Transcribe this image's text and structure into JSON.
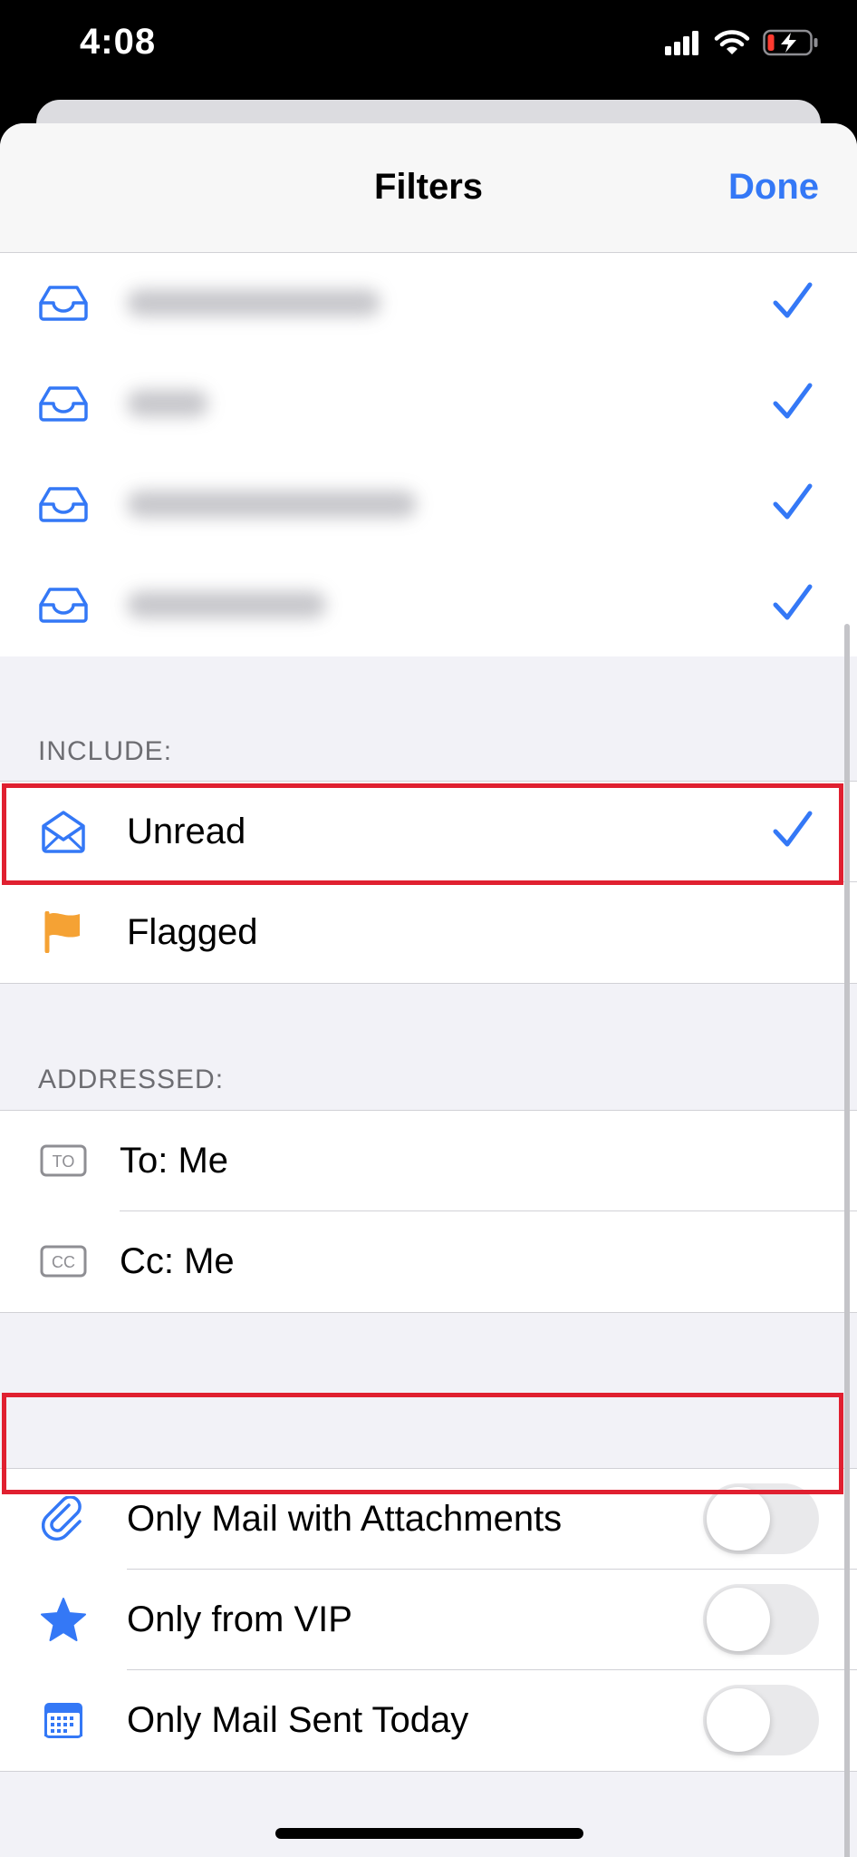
{
  "status": {
    "time": "4:08"
  },
  "nav": {
    "title": "Filters",
    "done": "Done"
  },
  "mailboxes": [
    {
      "icon": "inbox-tray-icon",
      "checked": true
    },
    {
      "icon": "inbox-tray-icon",
      "checked": true
    },
    {
      "icon": "inbox-tray-icon",
      "checked": true
    },
    {
      "icon": "inbox-tray-icon",
      "checked": true
    }
  ],
  "include": {
    "header": "INCLUDE:",
    "items": [
      {
        "label": "Unread",
        "icon": "envelope-open-icon",
        "checked": true
      },
      {
        "label": "Flagged",
        "icon": "flag-icon",
        "checked": false
      }
    ]
  },
  "addressed": {
    "header": "ADDRESSED:",
    "items": [
      {
        "label": "To: Me",
        "icon": "to-badge-icon",
        "badge": "TO"
      },
      {
        "label": "Cc: Me",
        "icon": "cc-badge-icon",
        "badge": "CC"
      }
    ]
  },
  "options": {
    "items": [
      {
        "label": "Only Mail with Attachments",
        "icon": "paperclip-icon",
        "on": false
      },
      {
        "label": "Only from VIP",
        "icon": "star-icon",
        "on": false
      },
      {
        "label": "Only Mail Sent Today",
        "icon": "calendar-icon",
        "on": false
      }
    ]
  },
  "colors": {
    "accent": "#3478f6",
    "flag": "#f5a234",
    "highlight": "#e02030"
  }
}
